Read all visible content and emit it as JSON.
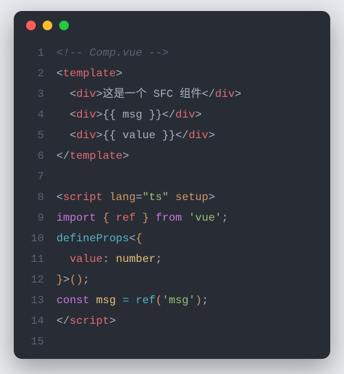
{
  "titlebar": {
    "dots": [
      "red",
      "yellow",
      "green"
    ]
  },
  "code": {
    "lines": [
      {
        "n": "1",
        "indent": "",
        "tokens": [
          {
            "t": "<!-- Comp.vue -->",
            "c": "comment"
          }
        ]
      },
      {
        "n": "2",
        "indent": "",
        "tokens": [
          {
            "t": "<",
            "c": "punct"
          },
          {
            "t": "template",
            "c": "tag"
          },
          {
            "t": ">",
            "c": "punct"
          }
        ]
      },
      {
        "n": "3",
        "indent": "  ",
        "tokens": [
          {
            "t": "<",
            "c": "punct"
          },
          {
            "t": "div",
            "c": "tag"
          },
          {
            "t": ">",
            "c": "punct"
          },
          {
            "t": "这是一个 SFC 组件",
            "c": "punct"
          },
          {
            "t": "</",
            "c": "punct"
          },
          {
            "t": "div",
            "c": "tag"
          },
          {
            "t": ">",
            "c": "punct"
          }
        ]
      },
      {
        "n": "4",
        "indent": "  ",
        "tokens": [
          {
            "t": "<",
            "c": "punct"
          },
          {
            "t": "div",
            "c": "tag"
          },
          {
            "t": ">",
            "c": "punct"
          },
          {
            "t": "{{ msg }}",
            "c": "punct"
          },
          {
            "t": "</",
            "c": "punct"
          },
          {
            "t": "div",
            "c": "tag"
          },
          {
            "t": ">",
            "c": "punct"
          }
        ]
      },
      {
        "n": "5",
        "indent": "  ",
        "tokens": [
          {
            "t": "<",
            "c": "punct"
          },
          {
            "t": "div",
            "c": "tag"
          },
          {
            "t": ">",
            "c": "punct"
          },
          {
            "t": "{{ value }}",
            "c": "punct"
          },
          {
            "t": "</",
            "c": "punct"
          },
          {
            "t": "div",
            "c": "tag"
          },
          {
            "t": ">",
            "c": "punct"
          }
        ]
      },
      {
        "n": "6",
        "indent": "",
        "tokens": [
          {
            "t": "</",
            "c": "punct"
          },
          {
            "t": "template",
            "c": "tag"
          },
          {
            "t": ">",
            "c": "punct"
          }
        ]
      },
      {
        "n": "7",
        "indent": "",
        "tokens": []
      },
      {
        "n": "8",
        "indent": "",
        "tokens": [
          {
            "t": "<",
            "c": "punct"
          },
          {
            "t": "script",
            "c": "tag"
          },
          {
            "t": " ",
            "c": "punct"
          },
          {
            "t": "lang",
            "c": "attr"
          },
          {
            "t": "=",
            "c": "punct"
          },
          {
            "t": "\"ts\"",
            "c": "string"
          },
          {
            "t": " ",
            "c": "punct"
          },
          {
            "t": "setup",
            "c": "attr"
          },
          {
            "t": ">",
            "c": "punct"
          }
        ]
      },
      {
        "n": "9",
        "indent": "",
        "tokens": [
          {
            "t": "import",
            "c": "keyword"
          },
          {
            "t": " ",
            "c": "punct"
          },
          {
            "t": "{",
            "c": "bracket"
          },
          {
            "t": " ref ",
            "c": "ident"
          },
          {
            "t": "}",
            "c": "bracket"
          },
          {
            "t": " ",
            "c": "punct"
          },
          {
            "t": "from",
            "c": "keyword"
          },
          {
            "t": " ",
            "c": "punct"
          },
          {
            "t": "'vue'",
            "c": "string"
          },
          {
            "t": ";",
            "c": "punct"
          }
        ]
      },
      {
        "n": "10",
        "indent": "",
        "tokens": [
          {
            "t": "defineProps",
            "c": "func"
          },
          {
            "t": "<",
            "c": "punct"
          },
          {
            "t": "{",
            "c": "bracket"
          }
        ]
      },
      {
        "n": "11",
        "indent": "  ",
        "tokens": [
          {
            "t": "value",
            "c": "ident"
          },
          {
            "t": ": ",
            "c": "punct"
          },
          {
            "t": "number",
            "c": "type"
          },
          {
            "t": ";",
            "c": "punct"
          }
        ]
      },
      {
        "n": "12",
        "indent": "",
        "tokens": [
          {
            "t": "}",
            "c": "bracket"
          },
          {
            "t": ">",
            "c": "punct"
          },
          {
            "t": "(",
            "c": "bracket"
          },
          {
            "t": ")",
            "c": "bracket"
          },
          {
            "t": ";",
            "c": "punct"
          }
        ]
      },
      {
        "n": "13",
        "indent": "",
        "tokens": [
          {
            "t": "const",
            "c": "keyword"
          },
          {
            "t": " ",
            "c": "punct"
          },
          {
            "t": "msg",
            "c": "type"
          },
          {
            "t": " ",
            "c": "punct"
          },
          {
            "t": "=",
            "c": "func"
          },
          {
            "t": " ",
            "c": "punct"
          },
          {
            "t": "ref",
            "c": "func"
          },
          {
            "t": "(",
            "c": "bracket"
          },
          {
            "t": "'msg'",
            "c": "string"
          },
          {
            "t": ")",
            "c": "bracket"
          },
          {
            "t": ";",
            "c": "punct"
          }
        ]
      },
      {
        "n": "14",
        "indent": "",
        "tokens": [
          {
            "t": "</",
            "c": "punct"
          },
          {
            "t": "script",
            "c": "tag"
          },
          {
            "t": ">",
            "c": "punct"
          }
        ]
      },
      {
        "n": "15",
        "indent": "",
        "tokens": []
      }
    ]
  }
}
